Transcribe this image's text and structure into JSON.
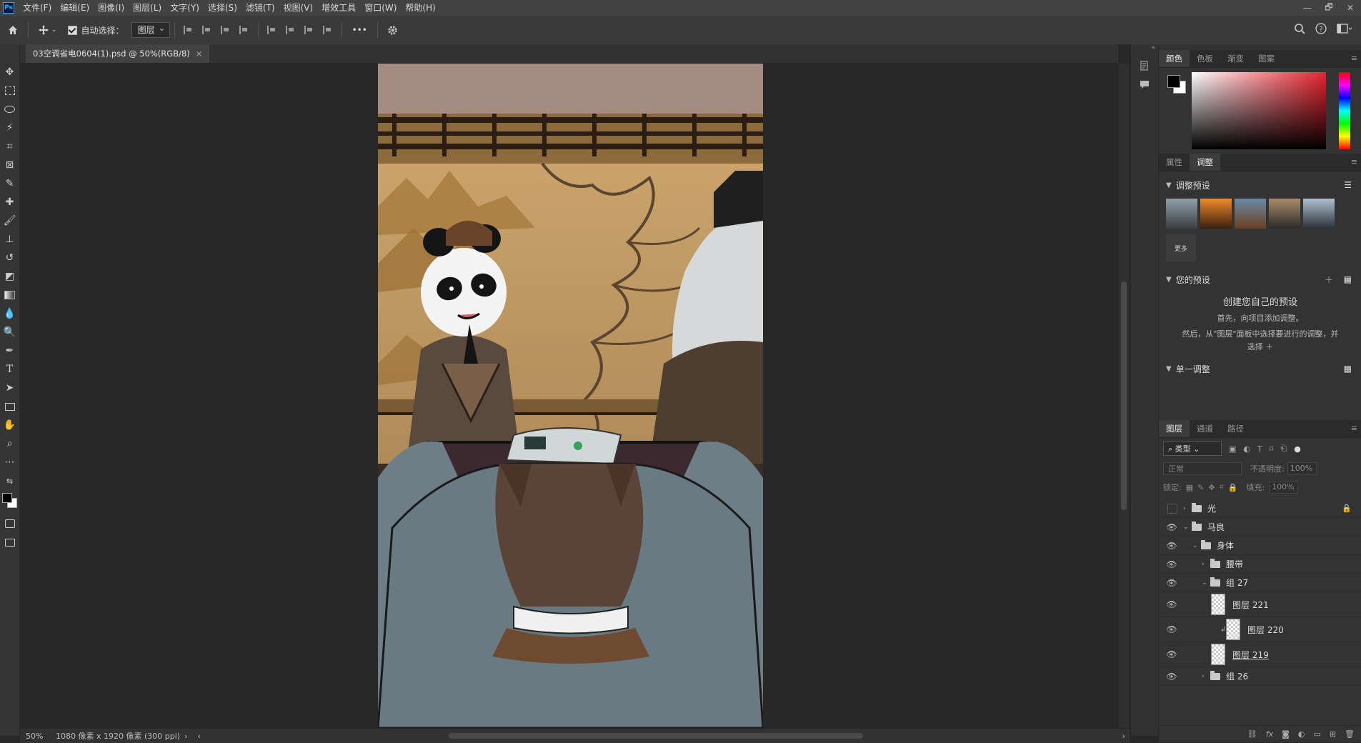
{
  "app": {
    "logo": "Ps"
  },
  "menu": [
    "文件(F)",
    "编辑(E)",
    "图像(I)",
    "图层(L)",
    "文字(Y)",
    "选择(S)",
    "滤镜(T)",
    "视图(V)",
    "增效工具",
    "窗口(W)",
    "帮助(H)"
  ],
  "window_controls": {
    "minimize": "—",
    "restore": "🗗",
    "close": "✕"
  },
  "options": {
    "auto_select_label": "自动选择：",
    "layer_select": "图层",
    "more": "•••"
  },
  "document": {
    "tab_title": "03空调省电0604(1).psd @ 50%(RGB/8)",
    "tab_close": "×"
  },
  "status": {
    "zoom": "50%",
    "info": "1080 像素 x 1920 像素 (300 ppi)",
    "arrow": "›",
    "left_arrow": "‹",
    "right_arrow": "›"
  },
  "color_panel": {
    "tabs": [
      "颜色",
      "色板",
      "渐变",
      "图案"
    ],
    "active": 0,
    "foreground": "#000000",
    "background": "#ffffff"
  },
  "adjust_panel": {
    "tabs": [
      "属性",
      "调整"
    ],
    "active": 1,
    "presets_title": "调整预设",
    "more_label": "更多",
    "your_presets_title": "您的预设",
    "create_title": "创建您自己的预设",
    "line1": "首先，向项目添加调整。",
    "line2": "然后，从\"图层\"面板中选择要进行的调整，并",
    "line3": "选择 ＋",
    "single_title": "单一调整"
  },
  "layers_panel": {
    "tabs": [
      "图层",
      "通道",
      "路径"
    ],
    "active": 0,
    "filter_label": "类型",
    "blend_mode": "正常",
    "opacity_label": "不透明度:",
    "opacity_value": "100%",
    "lock_label": "锁定:",
    "fill_label": "填充:",
    "fill_value": "100%",
    "layers": [
      {
        "name": "光",
        "type": "group",
        "indent": 0,
        "visible": false,
        "expanded": false,
        "locked": true
      },
      {
        "name": "马良",
        "type": "group",
        "indent": 0,
        "visible": true,
        "expanded": true
      },
      {
        "name": "身体",
        "type": "group",
        "indent": 1,
        "visible": true,
        "expanded": true
      },
      {
        "name": "腰带",
        "type": "group",
        "indent": 2,
        "visible": true,
        "expanded": false
      },
      {
        "name": "组 27",
        "type": "group",
        "indent": 2,
        "visible": true,
        "expanded": true
      },
      {
        "name": "图层 221",
        "type": "layer",
        "indent": 3,
        "visible": true
      },
      {
        "name": "图层 220",
        "type": "layer",
        "indent": 4,
        "visible": true,
        "clipped": true
      },
      {
        "name": "图层 219",
        "type": "layer",
        "indent": 3,
        "visible": true,
        "underline": true
      },
      {
        "name": "组 26",
        "type": "group",
        "indent": 2,
        "visible": true,
        "expanded": false
      }
    ]
  },
  "footer_icons": [
    "link-icon",
    "fx-icon",
    "mask-icon",
    "adjustment-icon",
    "group-icon",
    "new-layer-icon",
    "trash-icon"
  ]
}
